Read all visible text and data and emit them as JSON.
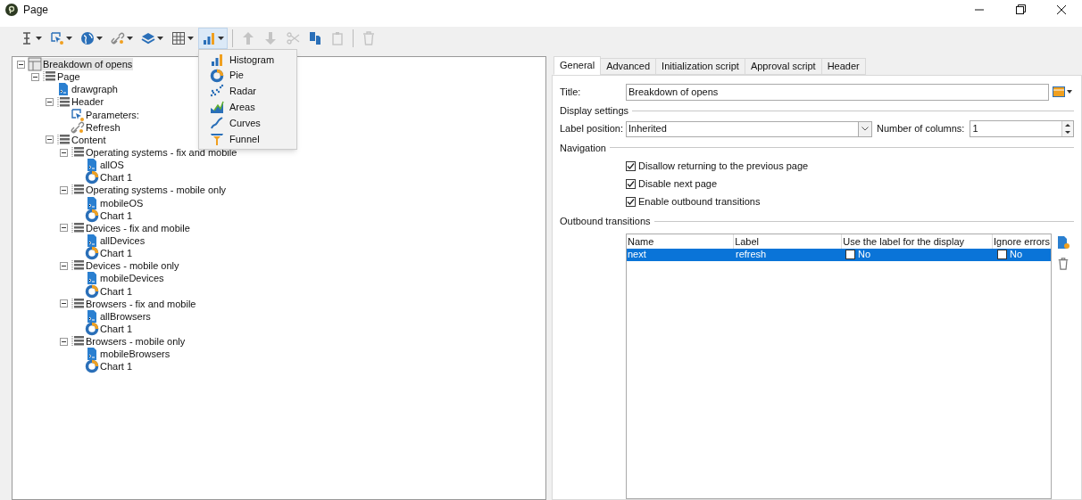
{
  "window": {
    "title": "Page"
  },
  "toolbar": [
    {
      "kind": "text",
      "caret": true,
      "disabled": false,
      "selected": false
    },
    {
      "kind": "param",
      "caret": true,
      "disabled": false,
      "selected": false
    },
    {
      "kind": "globe",
      "caret": true,
      "disabled": false,
      "selected": false
    },
    {
      "kind": "link",
      "caret": true,
      "disabled": false,
      "selected": false
    },
    {
      "kind": "layers",
      "caret": true,
      "disabled": false,
      "selected": false
    },
    {
      "kind": "grid",
      "caret": true,
      "disabled": false,
      "selected": false
    },
    {
      "kind": "chart",
      "caret": true,
      "disabled": false,
      "selected": true
    },
    {
      "kind": "sep"
    },
    {
      "kind": "up",
      "caret": false,
      "disabled": true,
      "selected": false
    },
    {
      "kind": "down",
      "caret": false,
      "disabled": true,
      "selected": false
    },
    {
      "kind": "cut",
      "caret": false,
      "disabled": true,
      "selected": false
    },
    {
      "kind": "copy",
      "caret": false,
      "disabled": false,
      "selected": false
    },
    {
      "kind": "paste",
      "caret": false,
      "disabled": true,
      "selected": false
    },
    {
      "kind": "sep"
    },
    {
      "kind": "delete",
      "caret": false,
      "disabled": true,
      "selected": false
    }
  ],
  "chart_menu": [
    {
      "label": "Histogram",
      "kind": "histogram"
    },
    {
      "label": "Pie",
      "kind": "pie"
    },
    {
      "label": "Radar",
      "kind": "radar"
    },
    {
      "label": "Areas",
      "kind": "areas"
    },
    {
      "label": "Curves",
      "kind": "curves"
    },
    {
      "label": "Funnel",
      "kind": "funnel"
    }
  ],
  "tree": [
    {
      "label": "Breakdown of opens",
      "kind": "form",
      "expanded": true,
      "selected": true,
      "children": [
        {
          "label": "Page",
          "kind": "container",
          "expanded": true,
          "selected": false,
          "children": [
            {
              "label": "drawgraph",
              "kind": "script",
              "selected": false
            },
            {
              "label": "Header",
              "kind": "container",
              "expanded": true,
              "selected": false,
              "children": [
                {
                  "label": "Parameters:",
                  "kind": "param",
                  "selected": false
                },
                {
                  "label": "Refresh",
                  "kind": "link",
                  "selected": false
                }
              ]
            },
            {
              "label": "Content",
              "kind": "container",
              "expanded": true,
              "selected": false,
              "children": [
                {
                  "label": "Operating systems - fix and mobile",
                  "kind": "container",
                  "expanded": true,
                  "selected": false,
                  "children": [
                    {
                      "label": "allOS",
                      "kind": "script",
                      "selected": false
                    },
                    {
                      "label": "Chart 1",
                      "kind": "chart",
                      "selected": false
                    }
                  ]
                },
                {
                  "label": "Operating systems - mobile only",
                  "kind": "container",
                  "expanded": true,
                  "selected": false,
                  "children": [
                    {
                      "label": "mobileOS",
                      "kind": "script",
                      "selected": false
                    },
                    {
                      "label": "Chart 1",
                      "kind": "chart",
                      "selected": false
                    }
                  ]
                },
                {
                  "label": "Devices - fix and mobile",
                  "kind": "container",
                  "expanded": true,
                  "selected": false,
                  "children": [
                    {
                      "label": "allDevices",
                      "kind": "script",
                      "selected": false
                    },
                    {
                      "label": "Chart 1",
                      "kind": "chart",
                      "selected": false
                    }
                  ]
                },
                {
                  "label": "Devices - mobile only",
                  "kind": "container",
                  "expanded": true,
                  "selected": false,
                  "children": [
                    {
                      "label": "mobileDevices",
                      "kind": "script",
                      "selected": false
                    },
                    {
                      "label": "Chart 1",
                      "kind": "chart",
                      "selected": false
                    }
                  ]
                },
                {
                  "label": "Browsers - fix and mobile",
                  "kind": "container",
                  "expanded": true,
                  "selected": false,
                  "children": [
                    {
                      "label": "allBrowsers",
                      "kind": "script",
                      "selected": false
                    },
                    {
                      "label": "Chart 1",
                      "kind": "chart",
                      "selected": false
                    }
                  ]
                },
                {
                  "label": "Browsers - mobile only",
                  "kind": "container",
                  "expanded": true,
                  "selected": false,
                  "children": [
                    {
                      "label": "mobileBrowsers",
                      "kind": "script",
                      "selected": false
                    },
                    {
                      "label": "Chart 1",
                      "kind": "chart",
                      "selected": false
                    }
                  ]
                }
              ]
            }
          ]
        }
      ]
    }
  ],
  "tabs": [
    {
      "label": "General",
      "selected": true
    },
    {
      "label": "Advanced",
      "selected": false
    },
    {
      "label": "Initialization script",
      "selected": false
    },
    {
      "label": "Approval script",
      "selected": false
    },
    {
      "label": "Header",
      "selected": false
    }
  ],
  "title_field": {
    "label": "Title:",
    "value": "Breakdown of opens"
  },
  "display_settings": {
    "heading": "Display settings",
    "label_position": {
      "label": "Label position:",
      "value": "Inherited"
    },
    "columns": {
      "label": "Number of columns:",
      "value": "1"
    }
  },
  "navigation": {
    "heading": "Navigation",
    "options": [
      {
        "label": "Disallow returning to the previous page",
        "checked": true
      },
      {
        "label": "Disable next page",
        "checked": true
      },
      {
        "label": "Enable outbound transitions",
        "checked": true
      }
    ]
  },
  "transitions": {
    "heading": "Outbound transitions",
    "columns": [
      "Name",
      "Label",
      "Use the label for the display",
      "Ignore errors"
    ],
    "rows": [
      {
        "name": "next",
        "label": "refresh",
        "use_label": {
          "checked": false,
          "text": "No"
        },
        "ignore_errors": {
          "checked": false,
          "text": "No"
        },
        "selected": true
      }
    ]
  }
}
